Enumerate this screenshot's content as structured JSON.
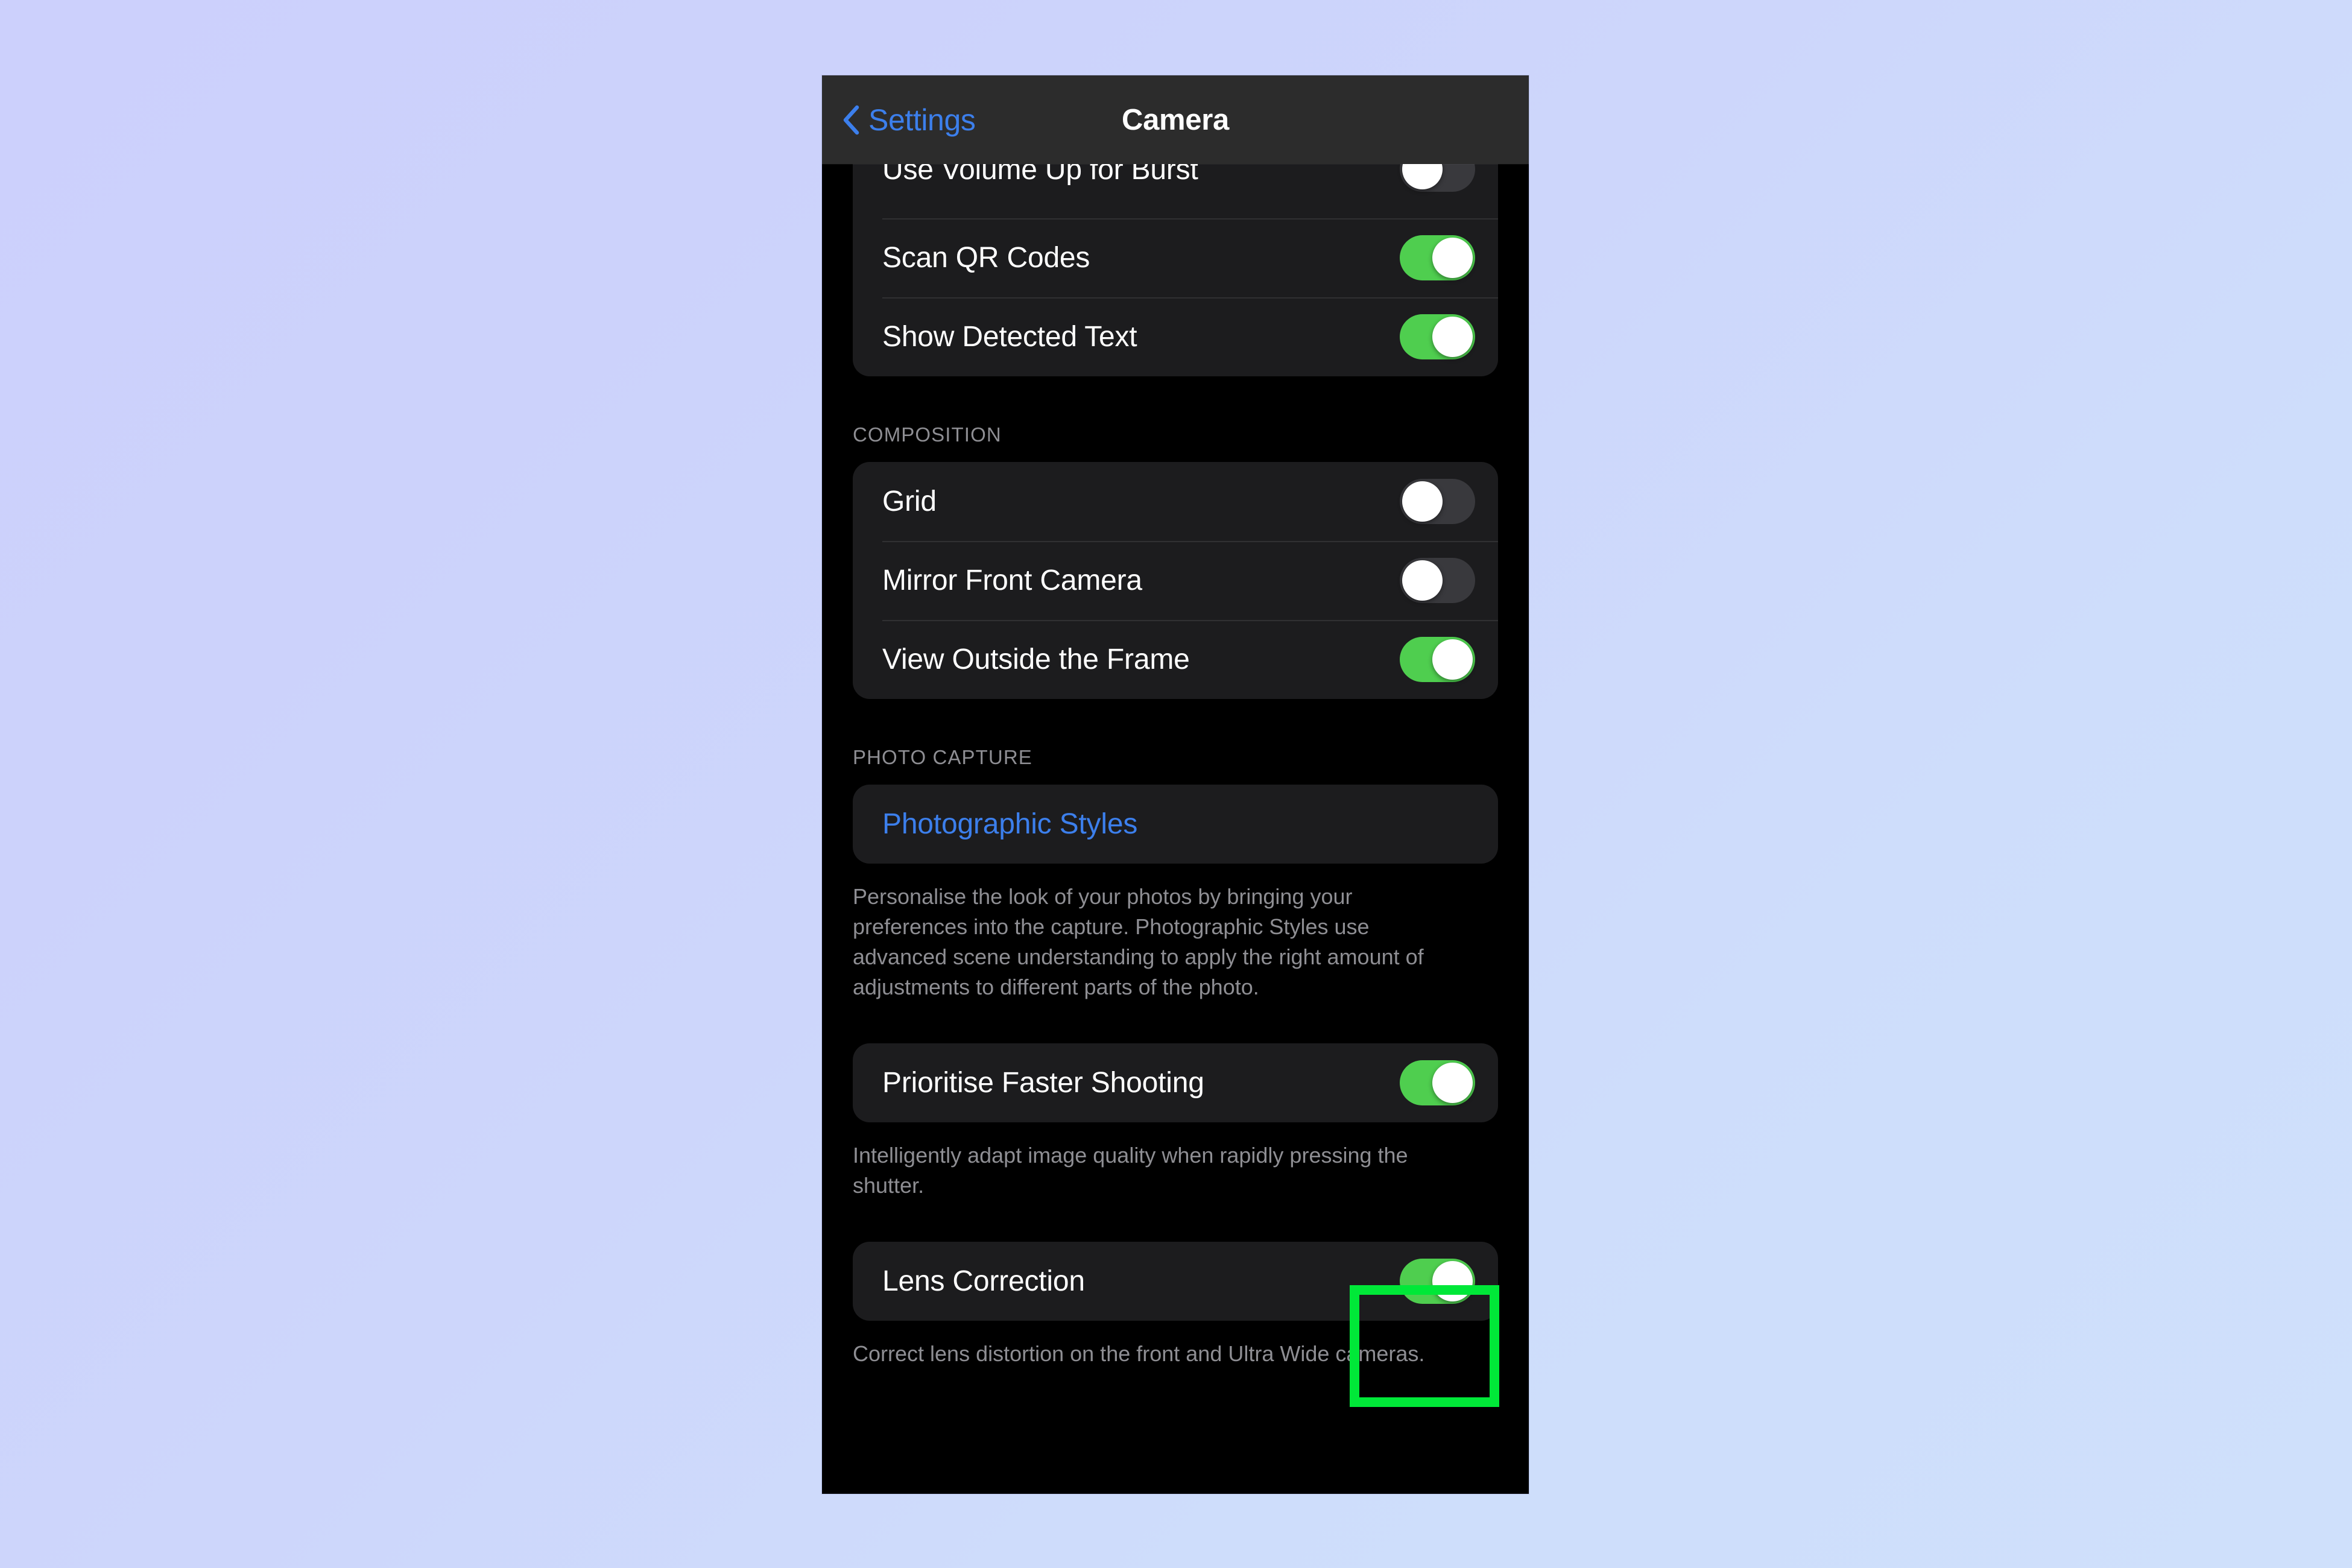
{
  "navbar": {
    "back_label": "Settings",
    "title": "Camera",
    "back_icon": "chevron-left-icon",
    "accent_color": "#3c7fec"
  },
  "colors": {
    "switch_on": "#4fce4f",
    "switch_off": "#39393d",
    "card_background": "#1c1c1e",
    "screen_background": "#000000",
    "navbar_background": "#2c2c2c",
    "link_blue": "#3c7fec",
    "secondary_text": "#8e8e93",
    "annotation_green": "#00e838",
    "page_gradient_start": "#ccd0fc",
    "page_gradient_end": "#cfe0fb"
  },
  "groups": {
    "top": {
      "rows": [
        {
          "label": "Use Volume Up for Burst",
          "state": "off"
        },
        {
          "label": "Scan QR Codes",
          "state": "on"
        },
        {
          "label": "Show Detected Text",
          "state": "on"
        }
      ]
    },
    "composition": {
      "header": "COMPOSITION",
      "rows": [
        {
          "label": "Grid",
          "state": "off"
        },
        {
          "label": "Mirror Front Camera",
          "state": "off"
        },
        {
          "label": "View Outside the Frame",
          "state": "on"
        }
      ]
    },
    "photo_capture": {
      "header": "PHOTO CAPTURE",
      "styles_row": {
        "label": "Photographic Styles"
      },
      "styles_footnote": "Personalise the look of your photos by bringing your preferences into the capture. Photographic Styles use advanced scene understanding to apply the right amount of adjustments to different parts of the photo.",
      "faster_shooting_row": {
        "label": "Prioritise Faster Shooting",
        "state": "on"
      },
      "faster_shooting_footnote": "Intelligently adapt image quality when rapidly pressing the shutter.",
      "lens_correction_row": {
        "label": "Lens Correction",
        "state": "on"
      },
      "lens_correction_footnote": "Correct lens distortion on the front and Ultra Wide cameras."
    }
  },
  "annotation": {
    "target": "lens-correction-toggle"
  }
}
